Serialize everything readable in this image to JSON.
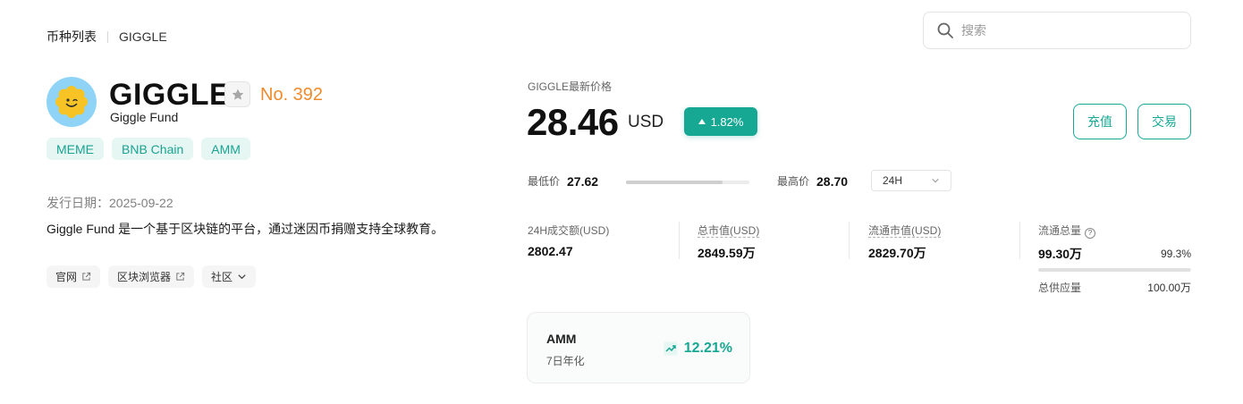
{
  "breadcrumb": {
    "root": "币种列表",
    "current": "GIGGLE"
  },
  "search": {
    "placeholder": "搜索"
  },
  "coin": {
    "symbol": "GIGGLE",
    "name": "Giggle Fund",
    "rank": "No. 392",
    "tags": [
      "MEME",
      "BNB Chain",
      "AMM"
    ],
    "issue_label": "发行日期：",
    "issue_date": "2025-09-22",
    "description": "Giggle Fund 是一个基于区块链的平台，通过迷因币捐赠支持全球教育。",
    "links": [
      {
        "label": "官网",
        "icon": "external-link-icon"
      },
      {
        "label": "区块浏览器",
        "icon": "external-link-icon"
      },
      {
        "label": "社区",
        "icon": "chevron-down-icon"
      }
    ]
  },
  "price": {
    "label": "GIGGLE最新价格",
    "value": "28.46",
    "unit": "USD",
    "change": "1.82%",
    "low_label": "最低价",
    "low": "27.62",
    "high_label": "最高价",
    "high": "28.70",
    "range_position": 0.78,
    "period": "24H"
  },
  "actions": {
    "deposit": "充值",
    "trade": "交易"
  },
  "stats": {
    "volume_label": "24H成交额(USD)",
    "volume": "2802.47",
    "market_cap_label": "总市值(USD)",
    "market_cap": "2849.59万",
    "circ_market_cap_label": "流通市值(USD)",
    "circ_market_cap": "2829.70万",
    "circ_supply_label": "流通总量",
    "circ_supply": "99.30万",
    "circ_supply_pct": "99.3%",
    "total_supply_label": "总供应量",
    "total_supply": "100.00万"
  },
  "amm": {
    "title": "AMM",
    "subtitle": "7日年化",
    "rate": "12.21%"
  },
  "colors": {
    "accent": "#17a894",
    "rank": "#ef8b2c",
    "tag_bg": "#e6f6f3",
    "logo_bg": "#8fd4f7"
  }
}
